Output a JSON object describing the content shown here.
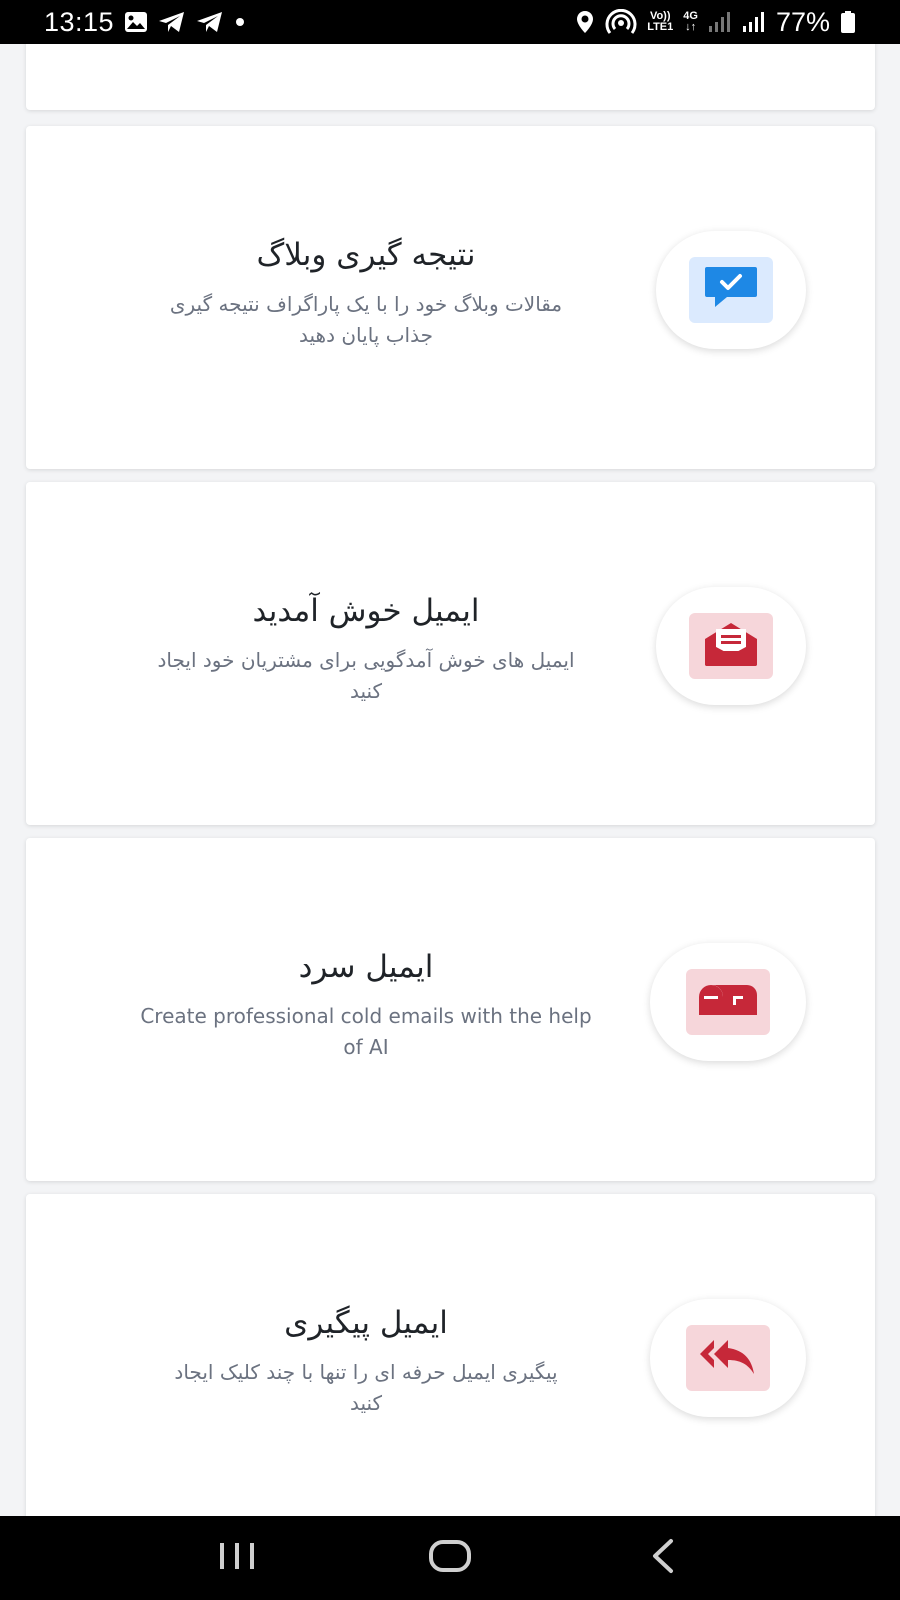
{
  "status_bar": {
    "time": "13:15",
    "battery_percent": "77%",
    "volte_top": "Vo))",
    "volte_bottom": "LTE1",
    "net_type": "4G",
    "icons_left": [
      "gallery-icon",
      "telegram-icon",
      "telegram-icon",
      "dot-icon"
    ],
    "icons_right": [
      "location-icon",
      "hotspot-icon",
      "volte-icon",
      "4g-icon",
      "signal-icon",
      "signal-icon",
      "battery-icon"
    ]
  },
  "cards": [
    {
      "title": "نتیجه گیری وبلاگ",
      "desc_line1": "مقالات وبلاگ خود را با یک پاراگراف نتیجه گیری",
      "desc_line2": "جذاب پایان دهید",
      "icon": "chat-check-icon",
      "tile_color": "#dbeafe",
      "icon_color": "#1e88e5"
    },
    {
      "title": "ایمیل خوش آمدید",
      "desc_line1": "ایمیل های خوش آمدگویی برای مشتریان خود ایجاد",
      "desc_line2": "کنید",
      "icon": "envelope-open-icon",
      "tile_color": "#f6d6da",
      "icon_color": "#c62839"
    },
    {
      "title": "ایمیل سرد",
      "desc_line1": "Create professional cold emails with the help",
      "desc_line2": "of AI",
      "icon": "mailbox-icon",
      "tile_color": "#f6d6da",
      "icon_color": "#c62839"
    },
    {
      "title": "ایمیل پیگیری",
      "desc_line1": "پیگیری ایمیل حرفه ای را تنها با چند کلیک ایجاد",
      "desc_line2": "کنید",
      "icon": "reply-all-icon",
      "tile_color": "#f6d6da",
      "icon_color": "#c62839"
    }
  ],
  "nav_bar": {
    "buttons": [
      "recent-apps-icon",
      "home-icon",
      "back-icon"
    ]
  }
}
